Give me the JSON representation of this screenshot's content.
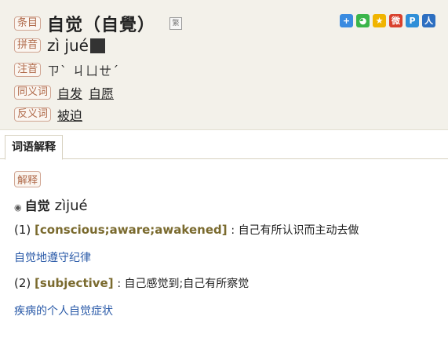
{
  "entry": {
    "tag_headword": "条目",
    "headword": "自觉（自覺）",
    "trad_icon_label": "繁",
    "tag_pinyin": "拼音",
    "pinyin": "zì jué",
    "tag_zhuyin": "注音",
    "zhuyin": "ㄗˋ ㄐㄩㄝˊ",
    "tag_synonym": "同义词",
    "synonyms": [
      "自发",
      "自愿"
    ],
    "tag_antonym": "反义词",
    "antonyms": [
      "被迫"
    ]
  },
  "share_icons": [
    {
      "name": "plus-share-icon",
      "color": "#3a8be0",
      "glyph": "+"
    },
    {
      "name": "wechat-icon",
      "color": "#3ab54a",
      "glyph": "◕"
    },
    {
      "name": "qzone-icon",
      "color": "#f0b400",
      "glyph": "★"
    },
    {
      "name": "weibo-icon",
      "color": "#d9412d",
      "glyph": "微"
    },
    {
      "name": "tencent-weibo-icon",
      "color": "#2f8fd8",
      "glyph": "P"
    },
    {
      "name": "renren-icon",
      "color": "#2d6fc1",
      "glyph": "人"
    }
  ],
  "tabs": [
    {
      "label": "词语解释"
    }
  ],
  "explanation": {
    "tag": "解释",
    "word": "自觉",
    "word_pinyin": "zìjué",
    "senses": [
      {
        "num": "(1)",
        "en": "[conscious;aware;awakened]",
        "zh": "自己有所认识而主动去做",
        "example": "自觉地遵守纪律"
      },
      {
        "num": "(2)",
        "en": "[subjective]",
        "zh": "自己感觉到;自己有所察觉",
        "example": "疾病的个人自觉症状"
      }
    ]
  }
}
